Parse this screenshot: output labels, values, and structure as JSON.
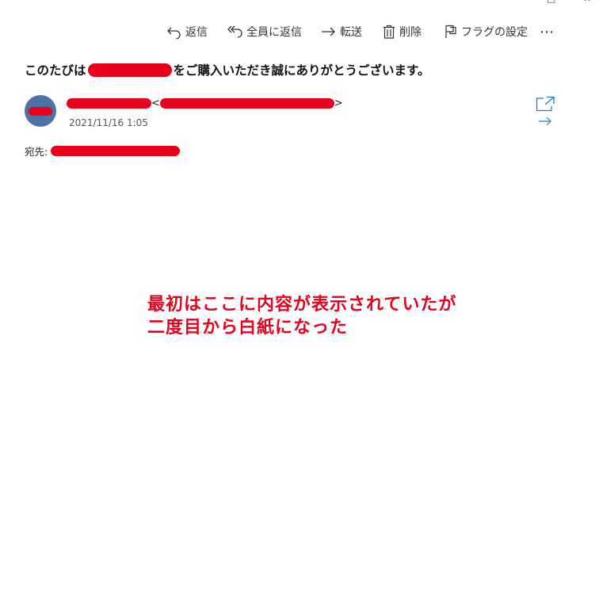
{
  "window": {
    "minimize_glyph": "□",
    "close_glyph": "✕"
  },
  "toolbar": {
    "reply": "返信",
    "reply_all": "全員に返信",
    "forward": "転送",
    "delete": "削除",
    "flag": "フラグの設定",
    "more": "⋯"
  },
  "message": {
    "subject_prefix": "このたびは",
    "subject_suffix": "をご購入いただき誠にありがとうございます。",
    "sender_lt": "<",
    "sender_gt": ">",
    "date": "2021/11/16 1:05",
    "to_label": "宛先:"
  },
  "annotation": {
    "line1": "最初はここに内容が表示されていたが",
    "line2": "二度目から白紙になった"
  },
  "colors": {
    "redaction": "#e8001d",
    "avatar": "#4d73a6",
    "icon_blue": "#2a7ab8"
  }
}
